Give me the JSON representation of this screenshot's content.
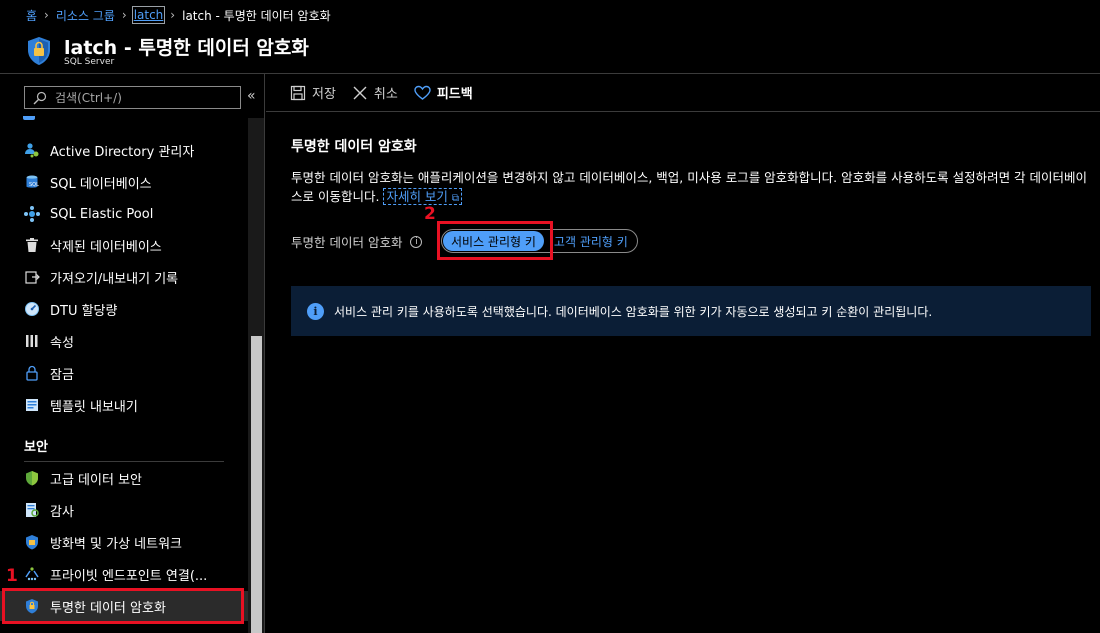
{
  "breadcrumb": {
    "home": "홈",
    "resource_groups": "리소스 그룹",
    "latch": "latch",
    "current": "latch - 투명한 데이터 암호화"
  },
  "header": {
    "title": "latch - 투명한 데이터 암호화",
    "subtitle": "SQL Server"
  },
  "sidebar": {
    "search_placeholder": "검색(Ctrl+/)",
    "collapse": "«",
    "items": [
      {
        "label": "Active Directory 관리자",
        "icon": "active-directory-icon"
      },
      {
        "label": "SQL 데이터베이스",
        "icon": "sql-database-icon"
      },
      {
        "label": "SQL Elastic Pool",
        "icon": "elastic-pool-icon"
      },
      {
        "label": "삭제된 데이터베이스",
        "icon": "trash-icon"
      },
      {
        "label": "가져오기/내보내기 기록",
        "icon": "import-export-icon"
      },
      {
        "label": "DTU 할당량",
        "icon": "gauge-icon"
      },
      {
        "label": "속성",
        "icon": "properties-icon"
      },
      {
        "label": "잠금",
        "icon": "lock-icon"
      },
      {
        "label": "템플릿 내보내기",
        "icon": "template-icon"
      }
    ],
    "security_section": "보안",
    "security_items": [
      {
        "label": "고급 데이터 보안",
        "icon": "shield-green-icon"
      },
      {
        "label": "감사",
        "icon": "audit-icon"
      },
      {
        "label": "방화벽 및 가상 네트워크",
        "icon": "firewall-icon"
      },
      {
        "label": "프라이빗 엔드포인트 연결(...",
        "icon": "private-endpoint-icon"
      },
      {
        "label": "투명한 데이터 암호화",
        "icon": "tde-shield-icon"
      }
    ]
  },
  "annotations": {
    "step1": "1",
    "step2": "2",
    "color": "#e81123"
  },
  "toolbar": {
    "save": "저장",
    "cancel": "취소",
    "feedback": "피드백"
  },
  "main": {
    "heading": "투명한 데이터 암호화",
    "description": "투명한 데이터 암호화는 애플리케이션을 변경하지 않고 데이터베이스, 백업, 미사용 로그를 암호화합니다. 암호화를 사용하도록 설정하려면 각 데이터베이스로 이동합니다.",
    "learn_more": "자세히 보기",
    "field_label": "투명한 데이터 암호화",
    "toggle_options": [
      "서비스 관리형 키",
      "고객 관리형 키"
    ],
    "selected_option": "서비스 관리형 키",
    "info_message": "서비스 관리 키를 사용하도록 선택했습니다. 데이터베이스 암호화를 위한 키가 자동으로 생성되고 키 순환이 관리됩니다."
  },
  "colors": {
    "accent": "#4f9ef8",
    "info_bg": "#0b1e36"
  }
}
